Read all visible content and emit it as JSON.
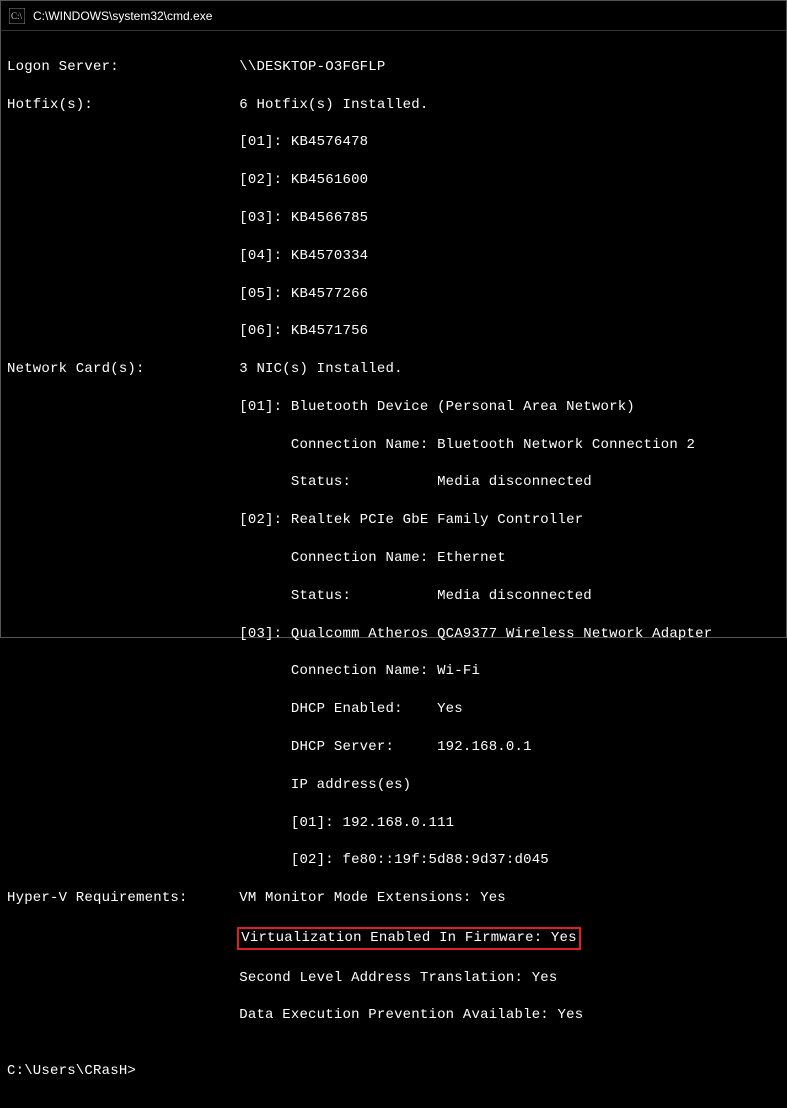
{
  "titlebar": {
    "title": "C:\\WINDOWS\\system32\\cmd.exe"
  },
  "terminal": {
    "logon_server_label": "Logon Server:",
    "logon_server_value": "\\\\DESKTOP-O3FGFLP",
    "hotfix_label": "Hotfix(s):",
    "hotfix_header": "6 Hotfix(s) Installed.",
    "hotfix_items": [
      "[01]: KB4576478",
      "[02]: KB4561600",
      "[03]: KB4566785",
      "[04]: KB4570334",
      "[05]: KB4577266",
      "[06]: KB4571756"
    ],
    "network_label": "Network Card(s):",
    "network_header": "3 NIC(s) Installed.",
    "nic1_title": "[01]: Bluetooth Device (Personal Area Network)",
    "nic1_conn": "Connection Name: Bluetooth Network Connection 2",
    "nic1_status": "Status:          Media disconnected",
    "nic2_title": "[02]: Realtek PCIe GbE Family Controller",
    "nic2_conn": "Connection Name: Ethernet",
    "nic2_status": "Status:          Media disconnected",
    "nic3_title": "[03]: Qualcomm Atheros QCA9377 Wireless Network Adapter",
    "nic3_conn": "Connection Name: Wi-Fi",
    "nic3_dhcp": "DHCP Enabled:    Yes",
    "nic3_dhcp_server": "DHCP Server:     192.168.0.1",
    "nic3_ip_label": "IP address(es)",
    "nic3_ip1": "[01]: 192.168.0.111",
    "nic3_ip2": "[02]: fe80::19f:5d88:9d37:d045",
    "hyperv_label": "Hyper-V Requirements:",
    "hyperv1": "VM Monitor Mode Extensions: Yes",
    "hyperv2": "Virtualization Enabled In Firmware: Yes",
    "hyperv3": "Second Level Address Translation: Yes",
    "hyperv4": "Data Execution Prevention Available: Yes",
    "prompt": "C:\\Users\\CRasH>"
  },
  "indent": {
    "col": "                           ",
    "sub": "                                 "
  }
}
